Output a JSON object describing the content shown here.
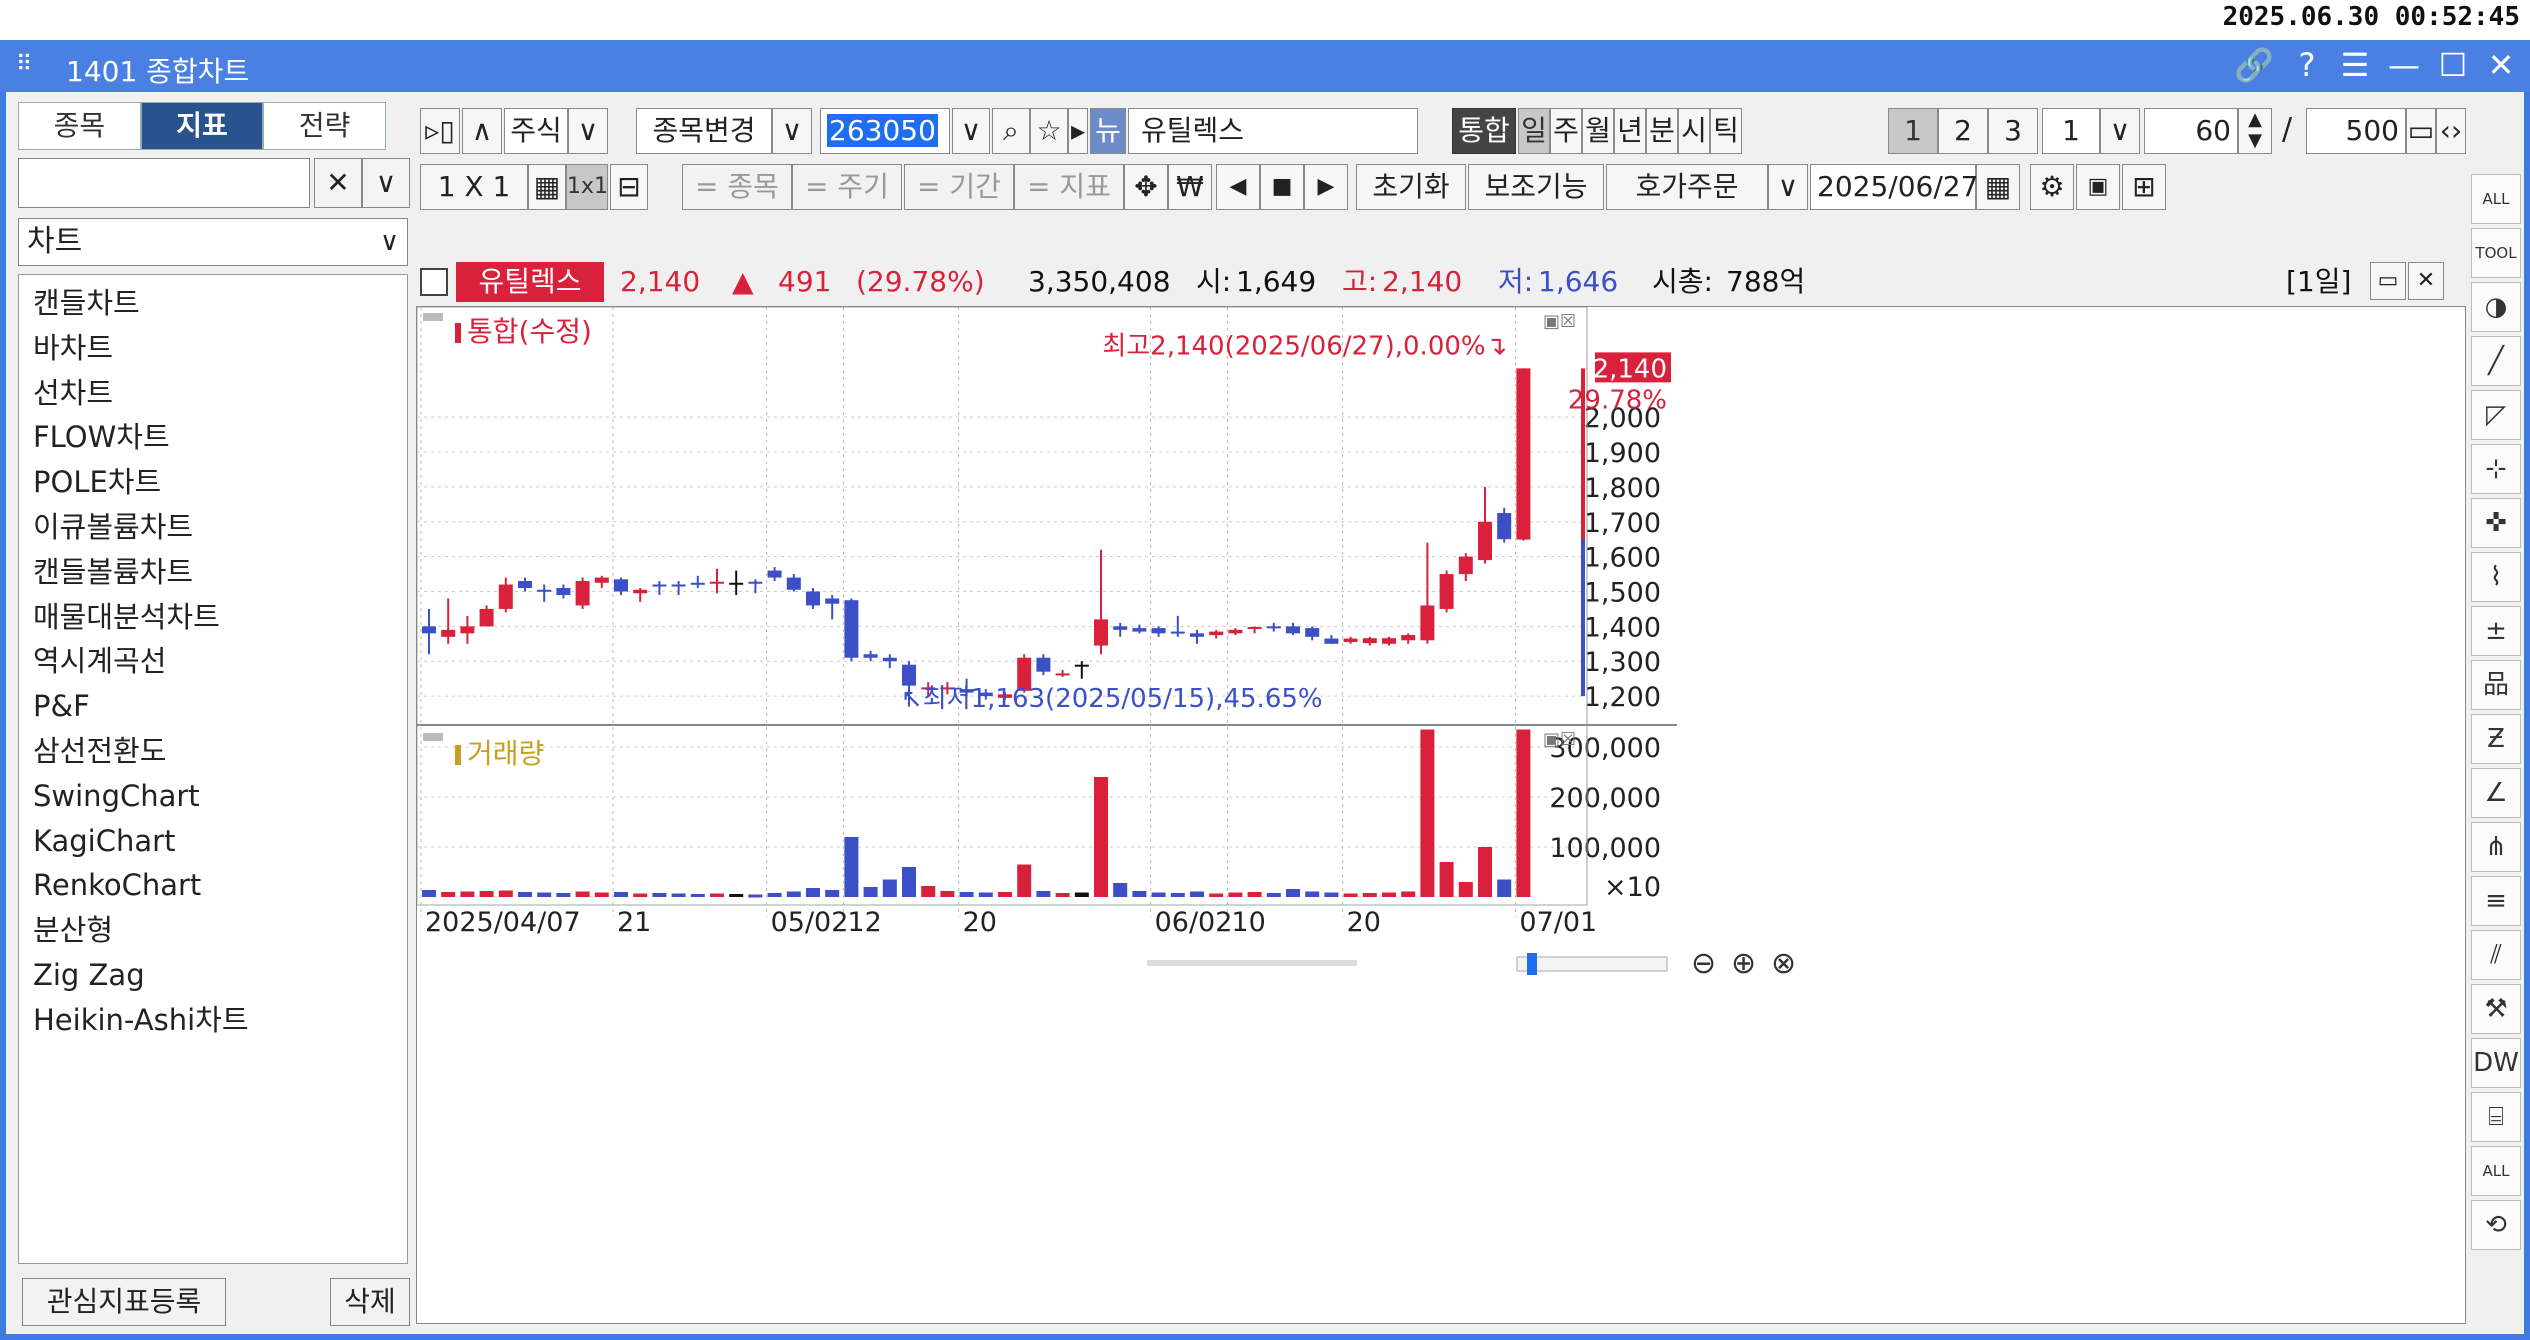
{
  "clock": "2025.06.30 00:52:45",
  "window": {
    "grip": "⠿",
    "title": "1401 종합차트",
    "controls": [
      "🔗",
      "?",
      "☰",
      "—",
      "☐",
      "✕"
    ]
  },
  "left_panel": {
    "tabs": [
      "종목",
      "지표",
      "전략"
    ],
    "active_tab": "지표",
    "search_placeholder": "",
    "clear_label": "✕",
    "dropdown_label": "∨",
    "category": "차트",
    "items": [
      "캔들차트",
      "바차트",
      "선차트",
      "FLOW차트",
      "POLE차트",
      "이큐볼륨차트",
      "캔들볼륨차트",
      "매물대분석차트",
      "역시계곡선",
      "P&F",
      "삼선전환도",
      "SwingChart",
      "KagiChart",
      "RenkoChart",
      "분산형",
      "Zig Zag",
      "Heikin-Ashi차트"
    ],
    "register_button": "관심지표등록",
    "delete_button": "삭제"
  },
  "toolbar1": {
    "expand": "▹▯",
    "up": "∧",
    "market": "주식",
    "change_label": "종목변경",
    "code": "263050",
    "search_icon": "⌕",
    "star_icon": "☆",
    "play_icon": "▸",
    "new_label": "뉴",
    "stock_name": "유틸렉스",
    "unified": "통합",
    "periods": [
      "일",
      "주",
      "월",
      "년",
      "분",
      "시",
      "틱"
    ],
    "active_period": "일",
    "pages": [
      "1",
      "2",
      "3"
    ],
    "interval": "1",
    "count1": "60",
    "slash": "/",
    "count2": "500"
  },
  "toolbar2": {
    "layout": "1 X 1",
    "grid_icon": "▦",
    "one_by_one": "1x1",
    "split_icon": "⊟",
    "stock": "= 종목",
    "cycle": "= 주기",
    "period": "= 기간",
    "indicator": "= 지표",
    "move_icon": "✥",
    "won_icon": "₩",
    "prev": "◀",
    "stop": "■",
    "next": "▶",
    "reset": "초기화",
    "aux": "보조기능",
    "order": "호가주문",
    "date": "2025/06/27",
    "calendar_icon": "▦"
  },
  "infobar": {
    "name": "유틸렉스",
    "price": "2,140",
    "arrow": "▲",
    "change": "491",
    "change_pct": "(29.78%)",
    "volume": "3,350,408",
    "open_label": "시:",
    "open": "1,649",
    "high_label": "고:",
    "high": "2,140",
    "low_label": "저:",
    "low": "1,646",
    "mcap_label": "시총:",
    "mcap": "788억",
    "period_tag": "[1일]"
  },
  "colors": {
    "up": "#d9213b",
    "down": "#3d4fc7",
    "neutral": "#111111",
    "titlebar": "#4a80e2",
    "volume_label": "#c8a020"
  },
  "chart_data": {
    "type": "candlestick",
    "legend_price": "통합(수정)",
    "legend_volume": "거래량",
    "x_ticks": [
      "2025/04/07",
      "21",
      "05/02",
      "12",
      "20",
      "06/02",
      "10",
      "20",
      "07/01"
    ],
    "y_ticks_price": [
      "2,000",
      "1,900",
      "1,800",
      "1,700",
      "1,600",
      "1,500",
      "1,400",
      "1,300",
      "1,200"
    ],
    "y_ticks_volume": [
      "300,000",
      "200,000",
      "100,000"
    ],
    "volume_unit": "×10",
    "ylim_price": [
      1140,
      2230
    ],
    "ylim_volume": [
      0,
      340000
    ],
    "last_price_label": "2,140",
    "last_pct_label": "29.78%",
    "annotation_high": "최고2,140(2025/06/27),0.00%",
    "annotation_low": "최저1,163(2025/05/15),45.65%",
    "candles": [
      {
        "o": 1400,
        "h": 1450,
        "l": 1320,
        "c": 1380,
        "v": 14000
      },
      {
        "o": 1370,
        "h": 1480,
        "l": 1350,
        "c": 1390,
        "v": 10000
      },
      {
        "o": 1380,
        "h": 1430,
        "l": 1350,
        "c": 1400,
        "v": 11000
      },
      {
        "o": 1400,
        "h": 1460,
        "l": 1400,
        "c": 1450,
        "v": 12000
      },
      {
        "o": 1450,
        "h": 1540,
        "l": 1440,
        "c": 1520,
        "v": 13000
      },
      {
        "o": 1530,
        "h": 1540,
        "l": 1500,
        "c": 1510,
        "v": 10000
      },
      {
        "o": 1505,
        "h": 1520,
        "l": 1470,
        "c": 1500,
        "v": 9000
      },
      {
        "o": 1510,
        "h": 1520,
        "l": 1480,
        "c": 1490,
        "v": 8000
      },
      {
        "o": 1460,
        "h": 1540,
        "l": 1450,
        "c": 1530,
        "v": 11000
      },
      {
        "o": 1525,
        "h": 1545,
        "l": 1510,
        "c": 1540,
        "v": 9000
      },
      {
        "o": 1535,
        "h": 1540,
        "l": 1490,
        "c": 1500,
        "v": 10000
      },
      {
        "o": 1495,
        "h": 1510,
        "l": 1470,
        "c": 1505,
        "v": 7000
      },
      {
        "o": 1520,
        "h": 1530,
        "l": 1490,
        "c": 1515,
        "v": 8000
      },
      {
        "o": 1520,
        "h": 1530,
        "l": 1490,
        "c": 1515,
        "v": 7000
      },
      {
        "o": 1525,
        "h": 1545,
        "l": 1510,
        "c": 1522,
        "v": 6000
      },
      {
        "o": 1525,
        "h": 1565,
        "l": 1495,
        "c": 1528,
        "v": 7000
      },
      {
        "o": 1525,
        "h": 1560,
        "l": 1490,
        "c": 1525,
        "v": 6000
      },
      {
        "o": 1528,
        "h": 1535,
        "l": 1495,
        "c": 1525,
        "v": 5000
      },
      {
        "o": 1560,
        "h": 1570,
        "l": 1530,
        "c": 1540,
        "v": 8000
      },
      {
        "o": 1540,
        "h": 1550,
        "l": 1500,
        "c": 1505,
        "v": 11000
      },
      {
        "o": 1500,
        "h": 1510,
        "l": 1450,
        "c": 1460,
        "v": 18000
      },
      {
        "o": 1480,
        "h": 1490,
        "l": 1420,
        "c": 1465,
        "v": 14000
      },
      {
        "o": 1475,
        "h": 1480,
        "l": 1300,
        "c": 1310,
        "v": 120000
      },
      {
        "o": 1320,
        "h": 1330,
        "l": 1300,
        "c": 1310,
        "v": 20000
      },
      {
        "o": 1310,
        "h": 1320,
        "l": 1280,
        "c": 1300,
        "v": 35000
      },
      {
        "o": 1290,
        "h": 1300,
        "l": 1170,
        "c": 1230,
        "v": 60000
      },
      {
        "o": 1220,
        "h": 1240,
        "l": 1200,
        "c": 1225,
        "v": 22000
      },
      {
        "o": 1220,
        "h": 1240,
        "l": 1205,
        "c": 1225,
        "v": 12000
      },
      {
        "o": 1220,
        "h": 1250,
        "l": 1200,
        "c": 1210,
        "v": 10000
      },
      {
        "o": 1210,
        "h": 1220,
        "l": 1190,
        "c": 1200,
        "v": 9000
      },
      {
        "o": 1195,
        "h": 1210,
        "l": 1190,
        "c": 1205,
        "v": 10000
      },
      {
        "o": 1215,
        "h": 1320,
        "l": 1210,
        "c": 1310,
        "v": 65000
      },
      {
        "o": 1310,
        "h": 1320,
        "l": 1260,
        "c": 1270,
        "v": 12000
      },
      {
        "o": 1260,
        "h": 1275,
        "l": 1255,
        "c": 1265,
        "v": 8000
      },
      {
        "o": 1290,
        "h": 1300,
        "l": 1250,
        "c": 1290,
        "v": 9000
      },
      {
        "o": 1345,
        "h": 1620,
        "l": 1320,
        "c": 1420,
        "v": 240000
      },
      {
        "o": 1400,
        "h": 1410,
        "l": 1370,
        "c": 1390,
        "v": 28000
      },
      {
        "o": 1395,
        "h": 1405,
        "l": 1380,
        "c": 1385,
        "v": 12000
      },
      {
        "o": 1395,
        "h": 1400,
        "l": 1370,
        "c": 1380,
        "v": 9000
      },
      {
        "o": 1385,
        "h": 1430,
        "l": 1370,
        "c": 1380,
        "v": 8000
      },
      {
        "o": 1380,
        "h": 1390,
        "l": 1350,
        "c": 1370,
        "v": 11000
      },
      {
        "o": 1375,
        "h": 1390,
        "l": 1365,
        "c": 1385,
        "v": 7000
      },
      {
        "o": 1380,
        "h": 1395,
        "l": 1375,
        "c": 1390,
        "v": 9000
      },
      {
        "o": 1395,
        "h": 1400,
        "l": 1380,
        "c": 1398,
        "v": 10000
      },
      {
        "o": 1400,
        "h": 1410,
        "l": 1385,
        "c": 1395,
        "v": 8000
      },
      {
        "o": 1400,
        "h": 1410,
        "l": 1375,
        "c": 1380,
        "v": 16000
      },
      {
        "o": 1395,
        "h": 1400,
        "l": 1360,
        "c": 1370,
        "v": 11000
      },
      {
        "o": 1365,
        "h": 1375,
        "l": 1350,
        "c": 1350,
        "v": 9000
      },
      {
        "o": 1355,
        "h": 1370,
        "l": 1350,
        "c": 1365,
        "v": 7000
      },
      {
        "o": 1352,
        "h": 1370,
        "l": 1345,
        "c": 1366,
        "v": 8000
      },
      {
        "o": 1350,
        "h": 1370,
        "l": 1345,
        "c": 1366,
        "v": 9000
      },
      {
        "o": 1360,
        "h": 1380,
        "l": 1350,
        "c": 1375,
        "v": 11000
      },
      {
        "o": 1360,
        "h": 1640,
        "l": 1350,
        "c": 1460,
        "v": 335000
      },
      {
        "o": 1450,
        "h": 1560,
        "l": 1440,
        "c": 1550,
        "v": 70000
      },
      {
        "o": 1550,
        "h": 1610,
        "l": 1530,
        "c": 1600,
        "v": 30000
      },
      {
        "o": 1590,
        "h": 1800,
        "l": 1580,
        "c": 1700,
        "v": 100000
      },
      {
        "o": 1725,
        "h": 1740,
        "l": 1640,
        "c": 1650,
        "v": 35000
      },
      {
        "o": 1649,
        "h": 2140,
        "l": 1646,
        "c": 2140,
        "v": 335000
      }
    ]
  },
  "right_tools": [
    "ALL",
    "TOOL",
    "◑",
    "╱",
    "◸",
    "⊹",
    "✜",
    "⌇",
    "±",
    "品",
    "Ƶ",
    "∠",
    "⋔",
    "≡",
    "⫽",
    "⚒",
    "DW",
    "⌸",
    "ALL",
    "⟲"
  ]
}
